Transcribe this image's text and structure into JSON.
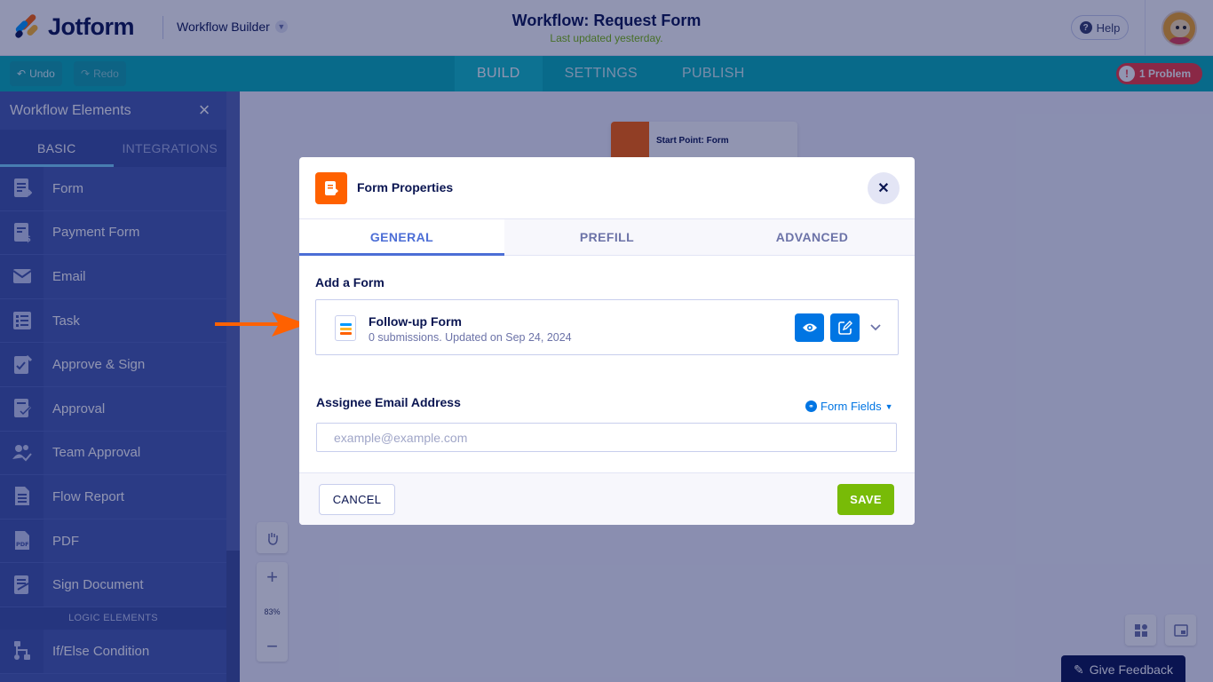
{
  "header": {
    "logo_text": "Jotform",
    "builder_select": "Workflow Builder",
    "workflow_title": "Workflow: Request Form",
    "last_updated": "Last updated yesterday.",
    "help_label": "Help"
  },
  "toolbar": {
    "undo_label": "Undo",
    "redo_label": "Redo",
    "tabs": [
      {
        "label": "BUILD",
        "active": true
      },
      {
        "label": "SETTINGS",
        "active": false
      },
      {
        "label": "PUBLISH",
        "active": false
      }
    ],
    "problem_label": "1 Problem"
  },
  "sidebar": {
    "title": "Workflow Elements",
    "tabs": [
      {
        "label": "BASIC",
        "active": true
      },
      {
        "label": "INTEGRATIONS",
        "active": false
      }
    ],
    "items": [
      {
        "label": "Form",
        "icon": "form-icon"
      },
      {
        "label": "Payment Form",
        "icon": "payment-form-icon"
      },
      {
        "label": "Email",
        "icon": "email-icon"
      },
      {
        "label": "Task",
        "icon": "task-icon"
      },
      {
        "label": "Approve & Sign",
        "icon": "approve-sign-icon"
      },
      {
        "label": "Approval",
        "icon": "approval-icon"
      },
      {
        "label": "Team Approval",
        "icon": "team-approval-icon"
      },
      {
        "label": "Flow Report",
        "icon": "flow-report-icon"
      },
      {
        "label": "PDF",
        "icon": "pdf-icon"
      },
      {
        "label": "Sign Document",
        "icon": "sign-document-icon"
      }
    ],
    "logic_section": "LOGIC ELEMENTS",
    "logic_items": [
      {
        "label": "If/Else Condition",
        "icon": "if-else-icon"
      }
    ]
  },
  "canvas": {
    "start_node_label": "Start Point: Form",
    "zoom_level": "83%",
    "feedback_label": "Give Feedback"
  },
  "modal": {
    "title": "Form Properties",
    "tabs": [
      {
        "label": "GENERAL",
        "active": true
      },
      {
        "label": "PREFILL",
        "active": false
      },
      {
        "label": "ADVANCED",
        "active": false
      }
    ],
    "add_form_label": "Add a Form",
    "form_name": "Follow-up Form",
    "form_meta": "0 submissions. Updated on Sep 24, 2024",
    "assignee_label": "Assignee Email Address",
    "form_fields_label": "Form Fields",
    "email_placeholder": "example@example.com",
    "email_value": "",
    "cancel_label": "CANCEL",
    "save_label": "SAVE"
  },
  "colors": {
    "brand_orange": "#ff6100",
    "toolbar_teal": "#06b1b9",
    "sidebar_blue": "#465cb0",
    "primary_blue": "#0075e3",
    "save_green": "#78bb07",
    "problem_red": "#f23a3c",
    "navy": "#0a1551"
  }
}
